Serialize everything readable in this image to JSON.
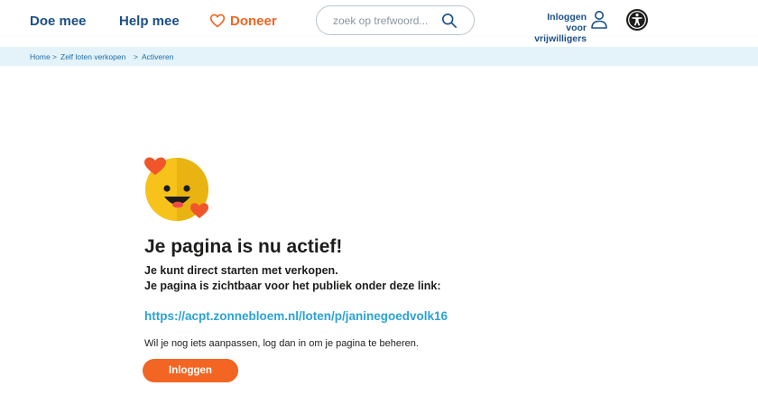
{
  "nav": {
    "doe_mee": "Doe mee",
    "help_mee": "Help mee",
    "doneer": "Doneer",
    "search_placeholder": "zoek op trefwoord...",
    "login_line1": "Inloggen voor",
    "login_line2": "vrijwilligers",
    "icons": [
      "heart-outline-icon",
      "search-icon",
      "user-icon",
      "accessibility-icon"
    ]
  },
  "breadcrumb": {
    "home": "Home",
    "sep": ">",
    "zelf_loten": "Zelf loten verkopen",
    "activeren": "Activeren"
  },
  "main": {
    "heading": "Je pagina is nu actief!",
    "line1": "Je kunt direct starten met verkopen.",
    "line2": "Je pagina is zichtbaar voor het publiek onder deze link:",
    "link": "https://acpt.zonnebloem.nl/loten/p/janinegoedvolk16",
    "note": "Wil je nog iets aanpassen, log dan in om je pagina te beheren.",
    "button": "Inloggen"
  },
  "colors": {
    "brand_blue": "#1b4f87",
    "orange": "#f26522",
    "link_blue": "#2aa3d6",
    "breadcrumb_bg": "#e4f3fa",
    "smiley_yellow": "#f7c21a"
  }
}
